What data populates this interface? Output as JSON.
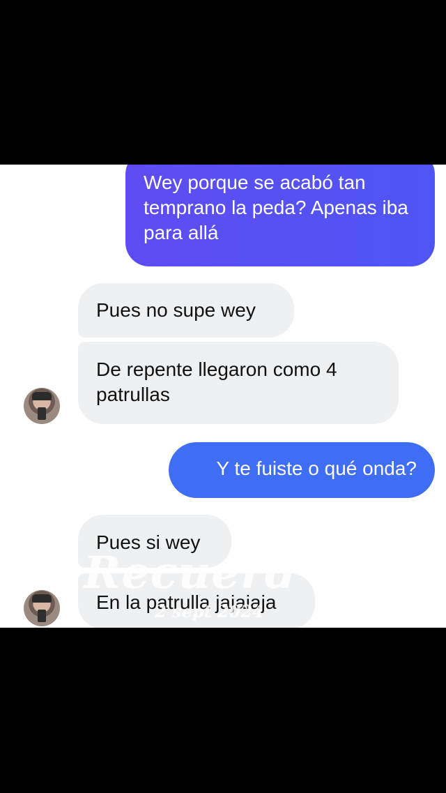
{
  "messages": [
    {
      "direction": "outgoing",
      "text": "Wey porque se acabó tan temprano la peda? Apenas iba para allá"
    },
    {
      "direction": "incoming",
      "text": "Pues no supe wey"
    },
    {
      "direction": "incoming",
      "text": "De repente llegaron como 4 patrullas"
    },
    {
      "direction": "outgoing",
      "text": "Y te fuiste o qué onda?"
    },
    {
      "direction": "incoming",
      "text": "Pues si wey"
    },
    {
      "direction": "incoming",
      "text": "En la patrulla jajaiaja"
    }
  ],
  "watermark": {
    "main": "Recuerd",
    "date": "2 sept 2024"
  },
  "colors": {
    "outgoing_gradient_start": "#5e4cf2",
    "outgoing_gradient_end": "#4f55f4",
    "outgoing_blue": "#3f6df3",
    "incoming_bg": "#eff0f2",
    "chat_bg": "#ffffff",
    "letterbox": "#000000"
  },
  "icons": [
    "contact-avatar-icon"
  ]
}
